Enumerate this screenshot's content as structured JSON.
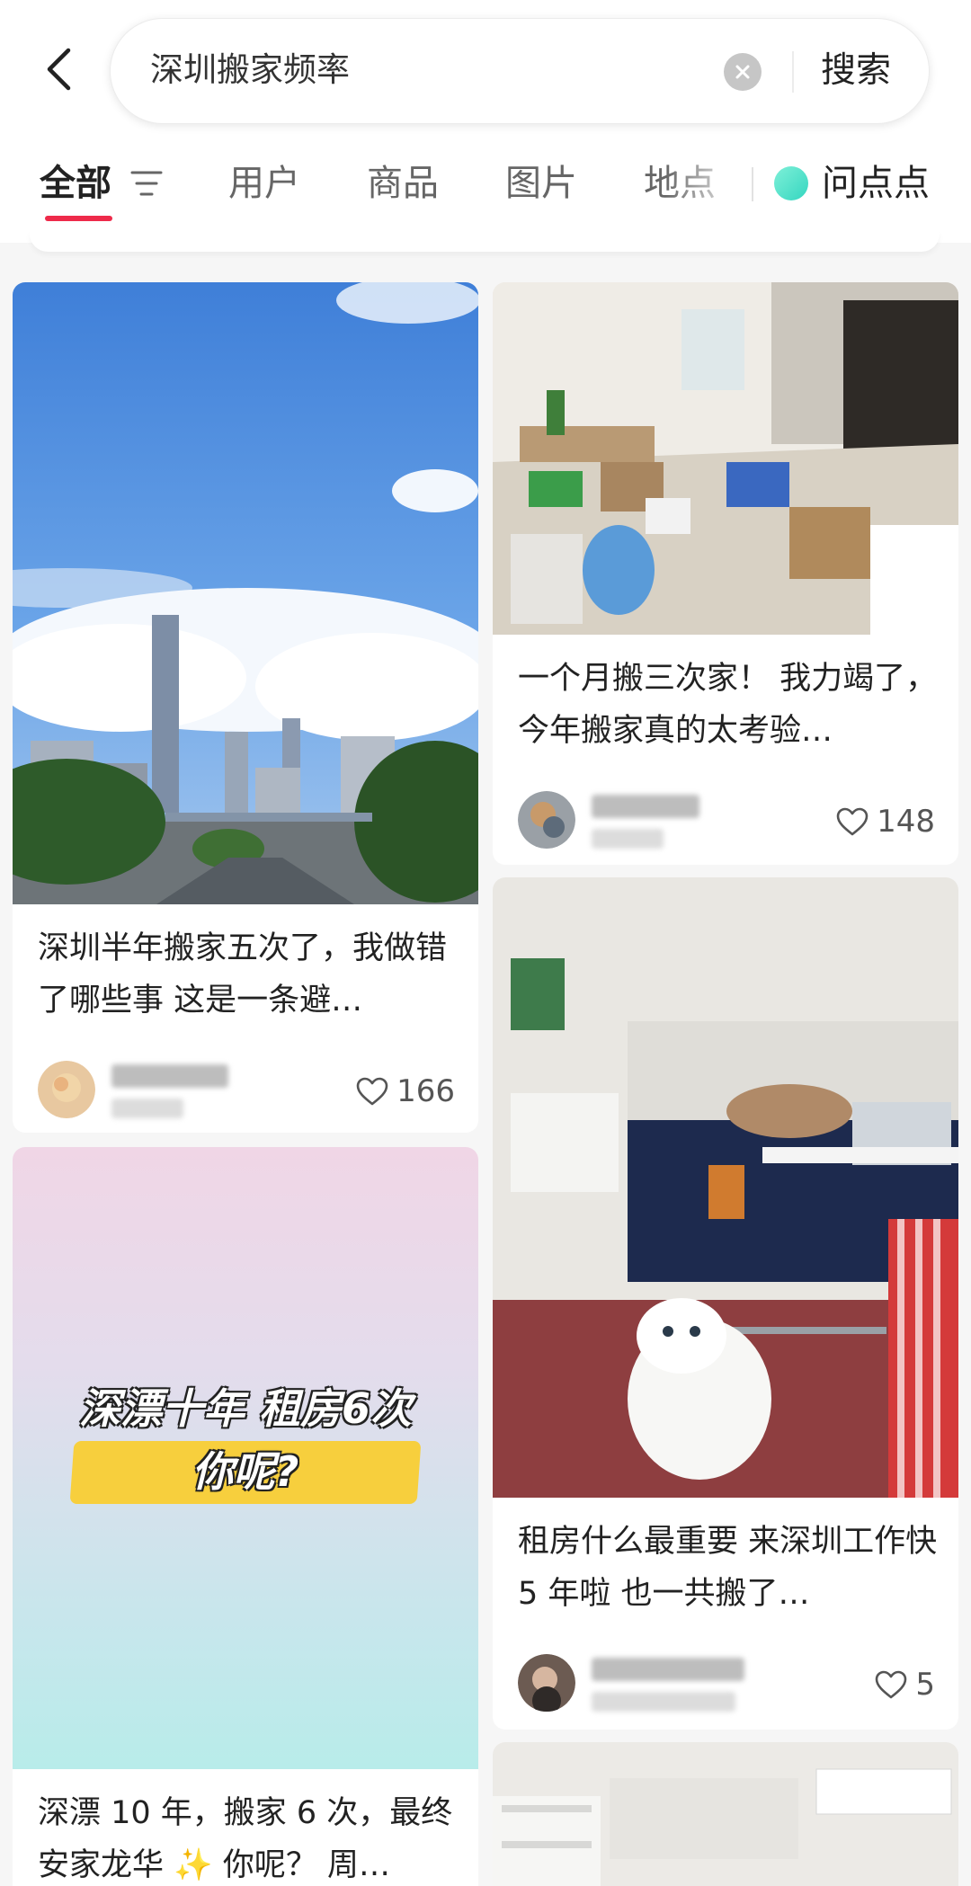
{
  "search": {
    "query": "深圳搬家频率",
    "submit_label": "搜索"
  },
  "tabs": [
    {
      "label": "全部",
      "active": true
    },
    {
      "label": "用户"
    },
    {
      "label": "商品"
    },
    {
      "label": "图片"
    },
    {
      "label": "地点"
    },
    {
      "label": "问点点"
    }
  ],
  "colors": {
    "accent": "#ee2a4a",
    "background": "#f6f6f6"
  },
  "notes": [
    {
      "title": "深圳半年搬家五次了，我做错了哪些事 这是一条避…",
      "likes": "166",
      "image": "city-skyline-photo"
    },
    {
      "title": "一个月搬三次家！ 我力竭了，今年搬家真的太考验…",
      "likes": "148",
      "image": "messy-room-moving-photo"
    },
    {
      "title": "租房什么最重要 来深圳工作快 5 年啦 也一共搬了…",
      "likes": "5",
      "image": "room-with-white-cat-photo"
    },
    {
      "title": "深漂 10 年，搬家 6 次，最终安家龙华 ✨ 你呢？ 周…",
      "image": "gradient-text-cover",
      "cover_line1": "深漂十年 租房6次",
      "cover_line2": "你呢?"
    },
    {
      "image": "empty-room-photo"
    }
  ]
}
